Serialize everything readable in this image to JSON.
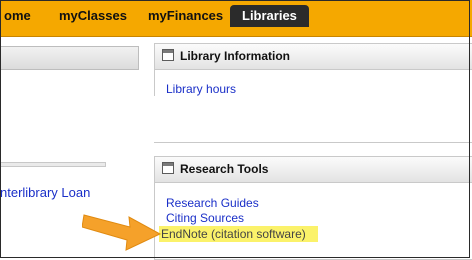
{
  "nav": {
    "tabs": [
      {
        "label": "ome"
      },
      {
        "label": "myClasses"
      },
      {
        "label": "myFinances"
      },
      {
        "label": "Libraries"
      }
    ]
  },
  "left": {
    "link": "nterlibrary Loan"
  },
  "library_info": {
    "title": "Library Information",
    "links": [
      "Library hours"
    ]
  },
  "research_tools": {
    "title": "Research Tools",
    "links": [
      "Research Guides",
      "Citing Sources",
      "EndNote (citation software)"
    ]
  },
  "colors": {
    "nav_bar": "#f5a800",
    "active_tab": "#2b2b2b",
    "link": "#1a2fc8",
    "highlight": "#fbf26a",
    "arrow": "#f5a12a"
  }
}
